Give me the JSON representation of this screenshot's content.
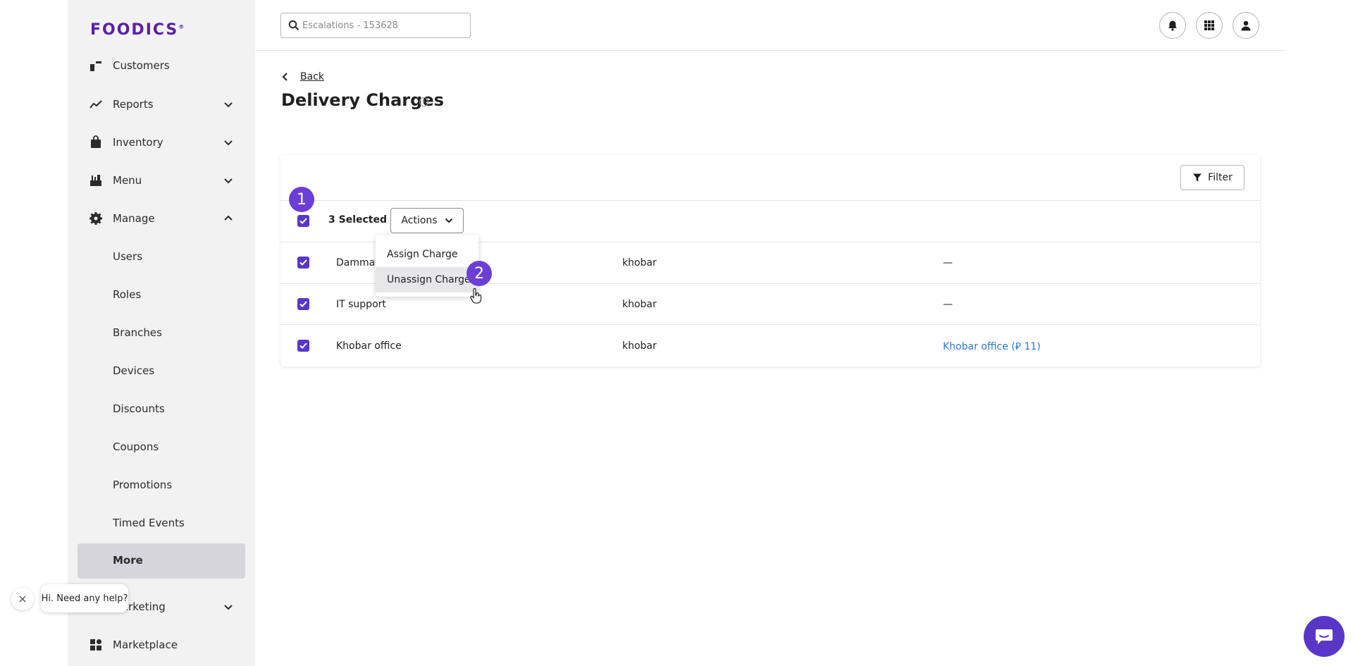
{
  "brand": {
    "logo_text": "FOODICS",
    "accent": "#5a36c8"
  },
  "sidebar": {
    "items": [
      {
        "label": "Customers",
        "icon": "customers-icon"
      },
      {
        "label": "Reports",
        "icon": "trend-chart-icon",
        "expandable": true
      },
      {
        "label": "Inventory",
        "icon": "shopping-bag-icon",
        "expandable": true
      },
      {
        "label": "Menu",
        "icon": "food-icon",
        "expandable": true
      },
      {
        "label": "Manage",
        "icon": "gear-icon",
        "expanded": true
      },
      {
        "label": "Marketing",
        "icon": "megaphone-icon",
        "expandable": true
      },
      {
        "label": "Marketplace",
        "icon": "apps-grid-icon"
      }
    ],
    "manage_sub": [
      "Users",
      "Roles",
      "Branches",
      "Devices",
      "Discounts",
      "Coupons",
      "Promotions",
      "Timed Events"
    ],
    "active_sub": "More"
  },
  "topbar": {
    "search_placeholder": "Escalations - 153628",
    "icons": [
      "bell-icon",
      "apps-icon",
      "user-icon"
    ]
  },
  "page": {
    "back_label": "Back",
    "title": "Delivery Charges"
  },
  "table": {
    "filter_label": "Filter",
    "selected_label": "3 Selected",
    "actions_label": "Actions",
    "rows": [
      {
        "name": "Dammam",
        "city": "khobar",
        "charge": "—",
        "checked": true
      },
      {
        "name": "IT support",
        "city": "khobar",
        "charge": "—",
        "checked": true
      },
      {
        "name": "Khobar office",
        "city": "khobar",
        "charge": "Khobar office (⃁ 11)",
        "checked": true
      }
    ]
  },
  "actions_menu": {
    "items": [
      "Assign Charge",
      "Unassign Charges"
    ],
    "hovered": "Unassign Charges"
  },
  "steps": [
    "1",
    "2"
  ],
  "help": {
    "bubble_text": "Hi. Need any help?"
  }
}
